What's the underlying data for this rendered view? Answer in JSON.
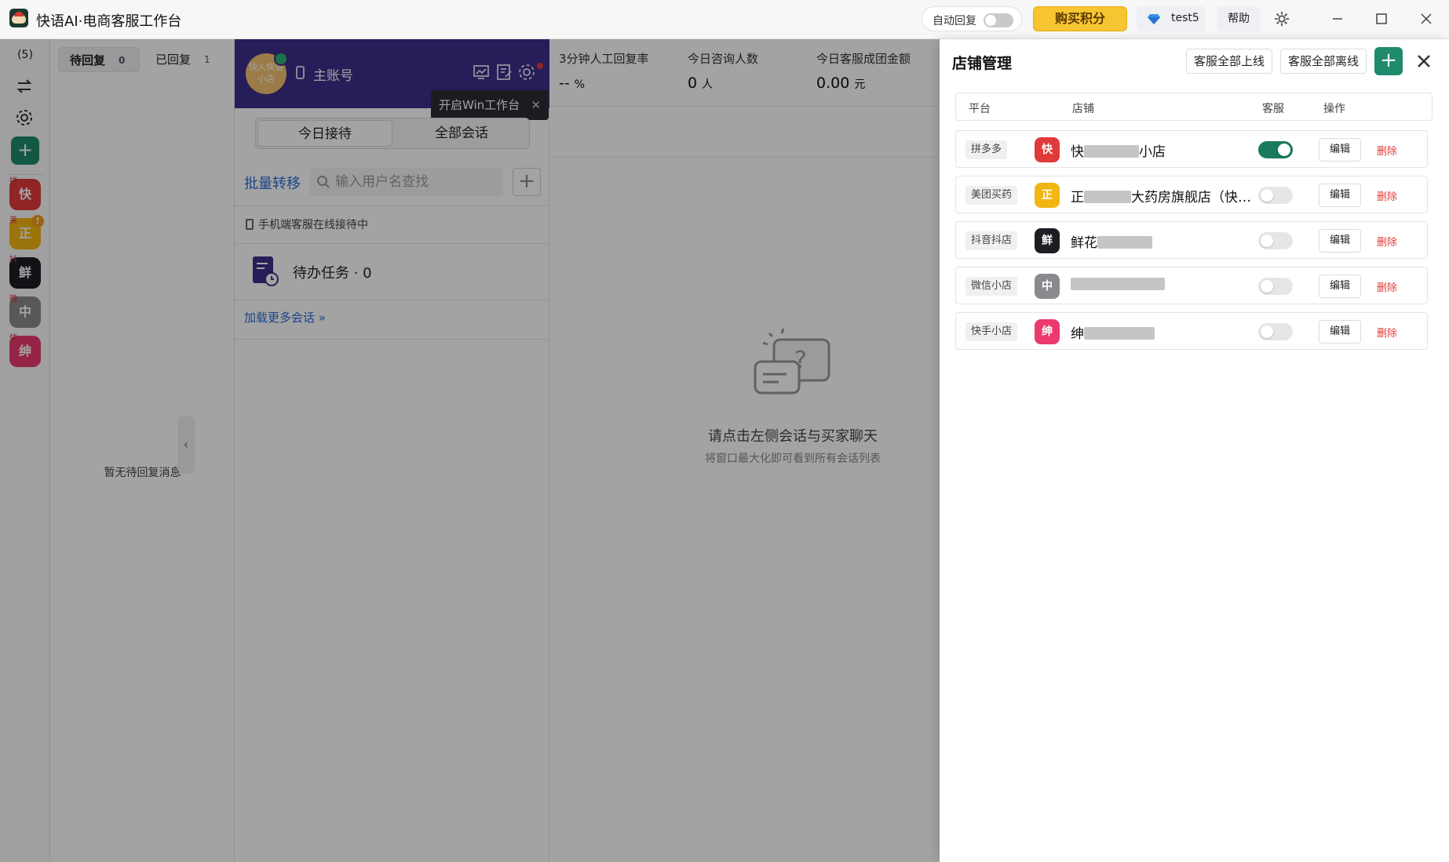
{
  "app": {
    "title": "快语AI·电商客服工作台"
  },
  "titlebar": {
    "auto_reply_label": "自动回复",
    "buy_label": "购买积分",
    "username": "test5",
    "help_label": "帮助"
  },
  "rail": {
    "count": "(5)",
    "shops": [
      {
        "tag": "拼",
        "char": "快",
        "color": "#e03a3a"
      },
      {
        "tag": "美",
        "char": "正",
        "color": "#f2b612",
        "warn": "!"
      },
      {
        "tag": "抖",
        "char": "鲜",
        "color": "#1d1d24"
      },
      {
        "tag": "微",
        "char": "中",
        "color": "#8a8a8e"
      },
      {
        "tag": "快",
        "char": "绅",
        "color": "#ea3a6e"
      }
    ]
  },
  "reply_panel": {
    "tabs": [
      {
        "label": "待回复",
        "count": "0"
      },
      {
        "label": "已回复",
        "count": "1"
      }
    ],
    "empty_text": "暂无待回复消息"
  },
  "session_panel": {
    "avatar_text": "快人快语小店",
    "account_name": "主账号",
    "tooltip": "开启Win工作台",
    "segments": [
      "今日接待",
      "全部会话"
    ],
    "bulk_transfer": "批量转移",
    "search_placeholder": "输入用户名查找",
    "mobile_status": "手机端客服在线接待中",
    "todo_label": "待办任务 · 0",
    "load_more": "加载更多会话"
  },
  "stats": [
    {
      "label": "3分钟人工回复率",
      "value": "-- ",
      "unit": "%"
    },
    {
      "label": "今日咨询人数",
      "value": "0 ",
      "unit": "人"
    },
    {
      "label": "今日客服成团金额",
      "value": "0.00 ",
      "unit": "元"
    }
  ],
  "chat_empty": {
    "title": "请点击左侧会话与买家聊天",
    "subtitle": "将窗口最大化即可看到所有会话列表"
  },
  "drawer": {
    "title": "店铺管理",
    "all_online": "客服全部上线",
    "all_offline": "客服全部离线",
    "columns": [
      "平台",
      "店铺",
      "客服",
      "操作"
    ],
    "edit_label": "编辑",
    "delete_label": "删除",
    "stores": [
      {
        "platform": "拼多多",
        "avatar": "快",
        "color": "#e03a3a",
        "name_pre": "快",
        "name_post": "小店",
        "service_on": true
      },
      {
        "platform": "美团买药",
        "avatar": "正",
        "color": "#f2b612",
        "name_pre": "正",
        "name_post": "大药房旗舰店（快…",
        "service_on": false
      },
      {
        "platform": "抖音抖店",
        "avatar": "鲜",
        "color": "#1d1d24",
        "name_pre": "鲜花",
        "name_post": "",
        "service_on": false
      },
      {
        "platform": "微信小店",
        "avatar": "中",
        "color": "#8a8a8e",
        "name_pre": "",
        "name_post": "",
        "service_on": false
      },
      {
        "platform": "快手小店",
        "avatar": "绅",
        "color": "#ea3a6e",
        "name_pre": "绅",
        "name_post": "",
        "service_on": false
      }
    ]
  }
}
